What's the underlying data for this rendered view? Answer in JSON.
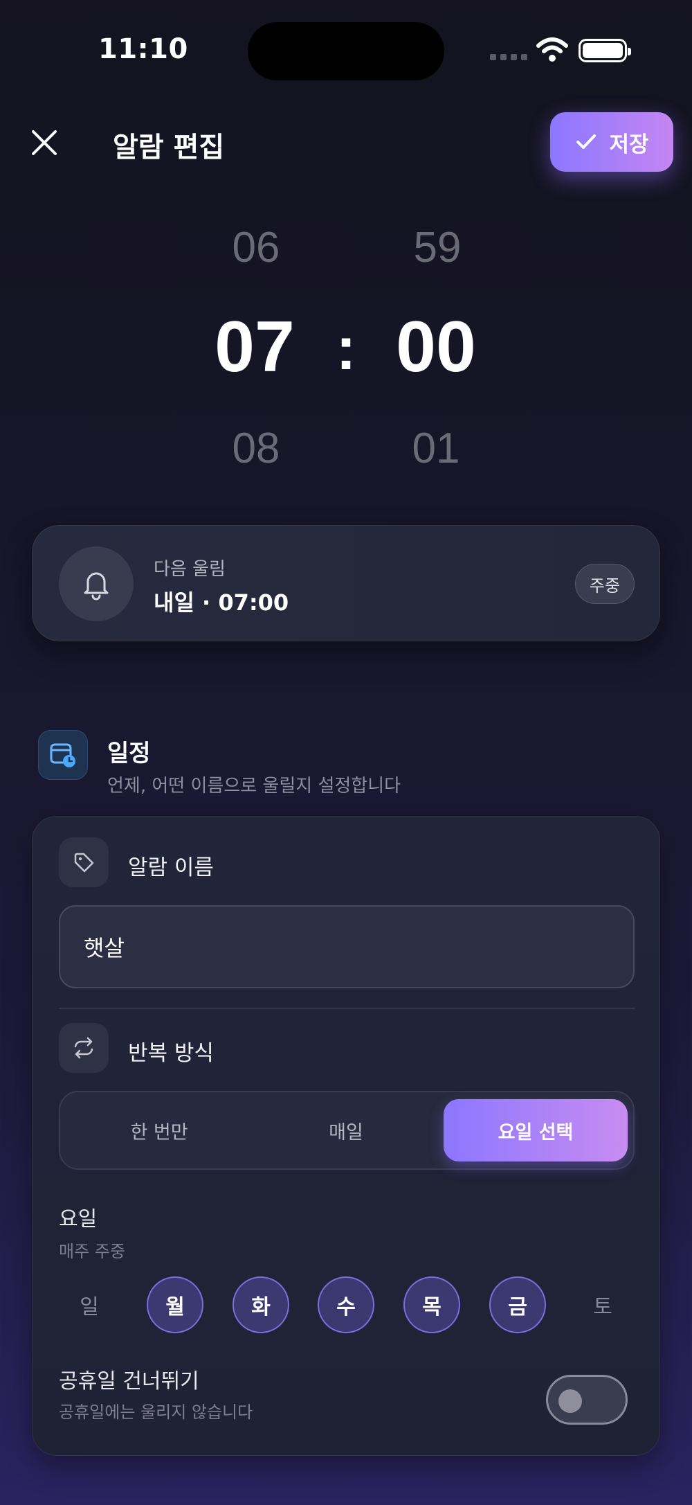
{
  "status_bar": {
    "time": "11:10"
  },
  "header": {
    "title": "알람 편집",
    "save_label": "저장"
  },
  "time_picker": {
    "hour_prev": "06",
    "hour": "07",
    "hour_next": "08",
    "minute_prev": "59",
    "minute": "00",
    "minute_next": "01",
    "separator": ":"
  },
  "next_alarm": {
    "label": "다음 울림",
    "value": "내일 · 07:00",
    "badge": "주중"
  },
  "section": {
    "title": "일정",
    "subtitle": "언제, 어떤 이름으로 울릴지 설정합니다"
  },
  "alarm_name": {
    "label": "알람 이름",
    "value": "햇살"
  },
  "repeat": {
    "label": "반복 방식",
    "options": [
      "한 번만",
      "매일",
      "요일 선택"
    ],
    "selected": "요일 선택"
  },
  "days": {
    "title": "요일",
    "subtitle": "매주 주중",
    "items": [
      {
        "label": "일",
        "selected": false
      },
      {
        "label": "월",
        "selected": true
      },
      {
        "label": "화",
        "selected": true
      },
      {
        "label": "수",
        "selected": true
      },
      {
        "label": "목",
        "selected": true
      },
      {
        "label": "금",
        "selected": true
      },
      {
        "label": "토",
        "selected": false
      }
    ]
  },
  "holiday_skip": {
    "title": "공휴일 건너뛰기",
    "subtitle": "공휴일에는 울리지 않습니다",
    "enabled": false
  },
  "colors": {
    "accent_start": "#8c77ff",
    "accent_end": "#c486f2",
    "section_icon": "#4aa8ff"
  },
  "icons": {
    "close": "close-icon",
    "save": "check-icon",
    "bell": "bell-icon",
    "section": "calendar-clock-icon",
    "tag": "tag-icon",
    "repeat": "repeat-icon"
  }
}
